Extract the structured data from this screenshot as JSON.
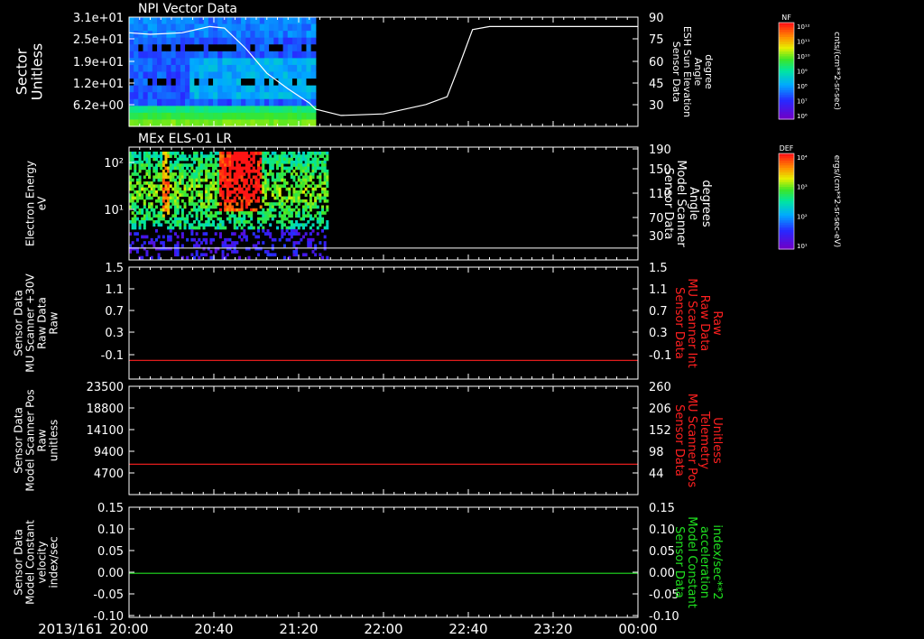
{
  "date_label": "2013/161",
  "x_ticks": [
    "20:00",
    "20:40",
    "21:20",
    "22:00",
    "22:40",
    "23:20",
    "00:00"
  ],
  "panels": [
    {
      "title": "NPI Vector Data",
      "left_label": [
        "Sector",
        "Unitless"
      ],
      "left_ticks": [
        "3.1e+01",
        "2.5e+01",
        "1.9e+01",
        "1.2e+01",
        "6.2e+00"
      ],
      "right_label": [
        "Sensor Data",
        "ESH Sun Elevation",
        "Angle",
        "degree"
      ],
      "right_ticks": [
        "90",
        "75",
        "60",
        "45",
        "30"
      ]
    },
    {
      "title": "MEx ELS-01 LR",
      "left_label": [
        "Electron Energy",
        "eV"
      ],
      "left_ticks": [
        "10²",
        "10¹"
      ],
      "right_label": [
        "Sensor Data",
        "Model Scanner",
        "Angle",
        "degrees"
      ],
      "right_ticks": [
        "190",
        "150",
        "110",
        "70",
        "30"
      ]
    },
    {
      "left_label": [
        "Sensor Data",
        "MU Scanner +30V",
        "Raw Data",
        "Raw"
      ],
      "left_ticks": [
        "1.5",
        "1.1",
        "0.7",
        "0.3",
        "-0.1"
      ],
      "right_label": [
        "Sensor Data",
        "MU Scanner Int",
        "Raw Data",
        "Raw"
      ],
      "right_ticks": [
        "1.5",
        "1.1",
        "0.7",
        "0.3",
        "-0.1"
      ]
    },
    {
      "left_label": [
        "Sensor Data",
        "Model Scanner Pos",
        "Raw",
        "unitless"
      ],
      "left_ticks": [
        "23500",
        "18800",
        "14100",
        "9400",
        "4700"
      ],
      "right_label": [
        "Sensor Data",
        "MU Scanner Pos",
        "Telemetry",
        "Unitless"
      ],
      "right_ticks": [
        "260",
        "206",
        "152",
        "98",
        "44"
      ]
    },
    {
      "left_label": [
        "Sensor Data",
        "Model Constant",
        "velocity",
        "index/sec"
      ],
      "left_ticks": [
        "0.15",
        "0.10",
        "0.05",
        "0.00",
        "-0.05",
        "-0.10"
      ],
      "right_label": [
        "Sensor Data",
        "Model Constant",
        "acceleration",
        "index/sec**2"
      ],
      "right_ticks": [
        "0.15",
        "0.10",
        "0.05",
        "0.00",
        "-0.05",
        "-0.10"
      ]
    }
  ],
  "colorbars": [
    {
      "title": "NF",
      "ticks": [
        "10¹²",
        "10¹¹",
        "10¹⁰",
        "10⁹",
        "10⁸",
        "10⁷",
        "10⁶"
      ],
      "unit": "cnts/(cm**2-sr-sec)"
    },
    {
      "title": "DEF",
      "ticks": [
        "10⁴",
        "10³",
        "10²",
        "10¹"
      ],
      "unit": "ergs/(cm**2-sr-sec-eV)"
    }
  ],
  "colors": {
    "background": "#000000",
    "axes": "#ffffff",
    "red_trace": "#ff2020",
    "green_trace": "#20e020",
    "red_label": "#ff2020",
    "green_label": "#20e020"
  },
  "chart_data": [
    {
      "type": "heatmap",
      "title": "NPI Vector Data",
      "x_range": [
        "2013/161 20:00",
        "2013/162 00:00"
      ],
      "data_extent": [
        "20:00",
        "21:28"
      ],
      "ylabel": "Sector Unitless",
      "colorbar": "NF cnts/(cm**2-sr-sec)",
      "overlay_line": {
        "name": "ESH Sun Elevation Angle",
        "unit": "degree",
        "ylim": [
          20,
          90
        ],
        "x_minutes": [
          0,
          10,
          25,
          38,
          45,
          55,
          65,
          75,
          85,
          88,
          100,
          120,
          140,
          150,
          156,
          162,
          170,
          240
        ],
        "y": [
          80,
          79,
          80,
          84,
          83,
          70,
          54,
          44,
          35,
          31,
          27,
          28,
          34,
          39,
          60,
          82,
          84,
          84
        ]
      }
    },
    {
      "type": "heatmap",
      "title": "MEx ELS-01 LR",
      "x_range": [
        "2013/161 20:00",
        "2013/162 00:00"
      ],
      "data_extent": [
        "20:00",
        "21:34"
      ],
      "ylabel": "Electron Energy eV",
      "yscale": "log",
      "colorbar": "DEF ergs/(cm**2-sr-sec-eV)",
      "overlay_line": {
        "name": "Model Scanner Angle",
        "unit": "degrees",
        "ylim": [
          0,
          190
        ],
        "x": [
          "20:00",
          "00:00"
        ],
        "y": [
          20,
          20
        ]
      }
    },
    {
      "type": "line",
      "ylim": [
        -0.3,
        1.5
      ],
      "series": [
        {
          "name": "MU Scanner +30V Raw Data",
          "x": [
            "20:00",
            "00:00"
          ],
          "y": [
            0,
            0
          ]
        }
      ]
    },
    {
      "type": "line",
      "ylim": [
        0,
        23500
      ],
      "series": [
        {
          "name": "Model Scanner Pos",
          "x": [
            "20:00",
            "00:00"
          ],
          "y": [
            6600,
            6600
          ]
        }
      ]
    },
    {
      "type": "line",
      "ylim": [
        -0.1,
        0.15
      ],
      "series": [
        {
          "name": "Model Constant velocity",
          "x": [
            "20:00",
            "00:00"
          ],
          "y": [
            0.0,
            0.0
          ]
        }
      ]
    }
  ]
}
